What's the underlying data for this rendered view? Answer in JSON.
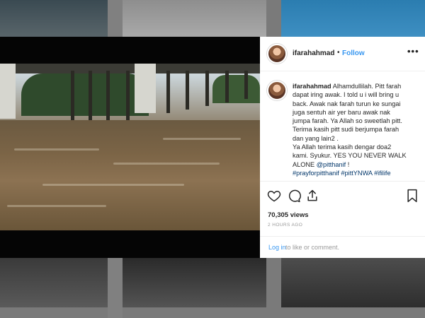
{
  "post": {
    "username": "ifarahahmad",
    "follow_label": "Follow",
    "dot": "•",
    "more_label": "•••",
    "caption_username": "ifarahahmad",
    "caption_lines": [
      "Alhamdullilah. Pitt farah",
      "dapat iring awak. I told u i will bring u",
      "back. Awak nak farah turun ke sungai",
      "juga sentuh air yer baru awak nak",
      "jumpa farah. Ya Allah so sweetlah pitt.",
      "Terima kasih pitt sudi berjumpa farah",
      "dan yang lain2 .",
      "Ya Allah terima kasih dengar doa2",
      "kami. Syukur. YES YOU NEVER WALK",
      "ALONE"
    ],
    "mention": "@pitthanif",
    "mention_suffix": " !",
    "hashtags": "#prayforpitthanif #pittYNWA #ifilife",
    "views": "70,305 views",
    "time_ago": "2 HOURS AGO",
    "login_label": "Log in",
    "login_rest": " to like or comment.",
    "icons": [
      "heart-icon",
      "comment-icon",
      "share-icon",
      "bookmark-icon",
      "more-options-icon"
    ],
    "colors": {
      "link": "#3897f0",
      "tag": "#003569",
      "text": "#262626",
      "muted": "#999999"
    }
  }
}
